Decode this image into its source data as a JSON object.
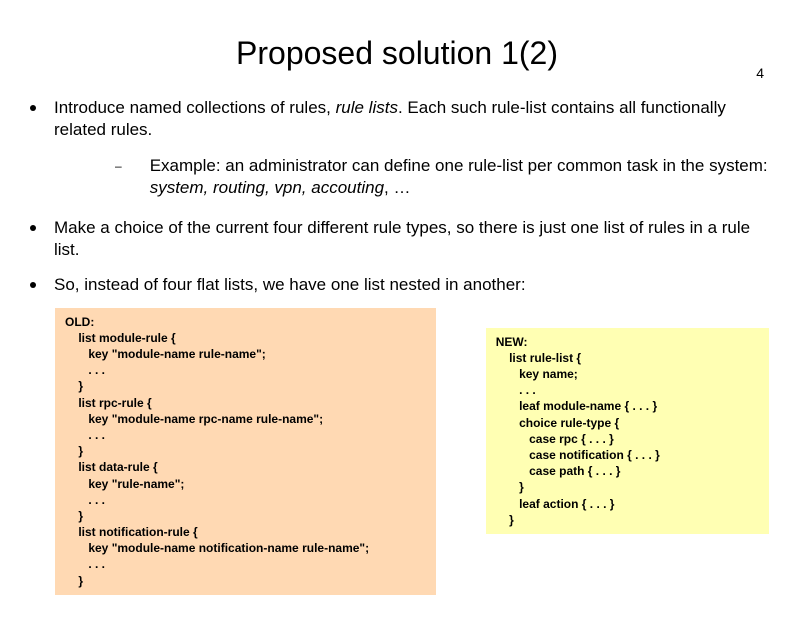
{
  "pageNumber": "4",
  "title": "Proposed solution 1(2)",
  "bullets": {
    "b1_pre": "Introduce named collections of rules, ",
    "b1_em": "rule lists",
    "b1_post": ".  Each such rule-list contains all functionally related rules.",
    "sub_pre": "Example: an administrator can define one rule-list per common task in the system: ",
    "sub_em": "system, routing, vpn, accouting",
    "sub_post": ", …",
    "b2": "Make a choice of the current four different rule types, so there is just one list of rules in a rule list.",
    "b3": "So, instead of four flat lists, we have one list nested in another:"
  },
  "code": {
    "old": "OLD:\n    list module-rule {\n       key \"module-name rule-name\";\n       . . .\n    }\n    list rpc-rule {\n       key \"module-name rpc-name rule-name\";\n       . . .\n    }\n    list data-rule {\n       key \"rule-name\";\n       . . .\n    }\n    list notification-rule {\n       key \"module-name notification-name rule-name\";\n       . . .\n    }",
    "new": "NEW:\n    list rule-list {\n       key name;\n       . . .\n       leaf module-name { . . . }\n       choice rule-type {\n          case rpc { . . . }\n          case notification { . . . }\n          case path { . . . }\n       }\n       leaf action { . . . }\n    }"
  }
}
